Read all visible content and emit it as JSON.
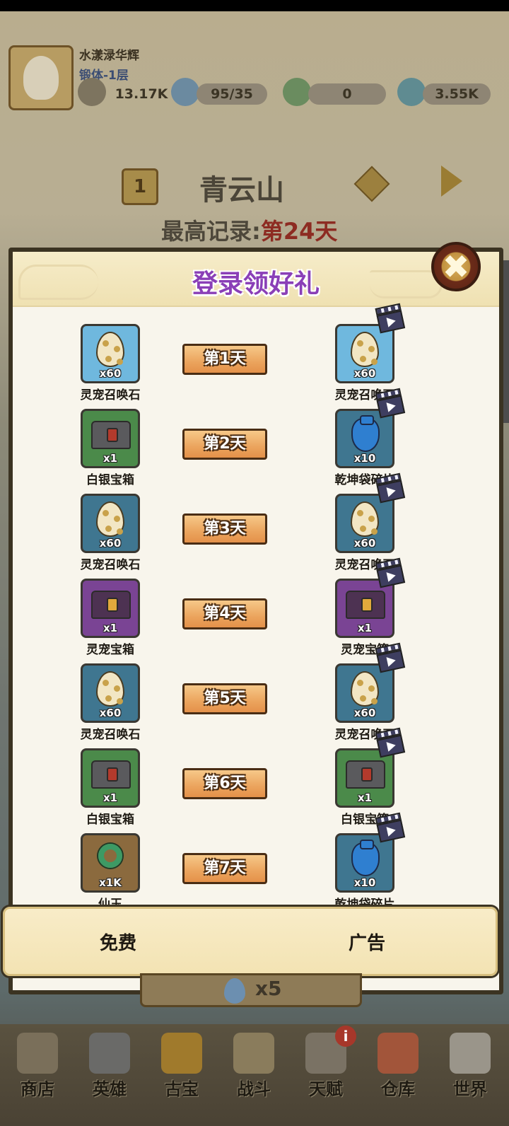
{
  "player": {
    "name": "水漾渌华辉",
    "rank": "锻体-1层",
    "power": "13.17K",
    "stamina": "95/35",
    "jade": "0",
    "crystal": "3.55K"
  },
  "region": {
    "level": "1",
    "name": "青云山",
    "record_label": "最高记录:",
    "record_value": "第24天"
  },
  "modal": {
    "title": "登录领好礼",
    "close_icon": "close-icon",
    "columns": {
      "free": "免费",
      "ad": "广告"
    },
    "rows": [
      {
        "day": "第1天",
        "free": {
          "name": "灵宠召唤石",
          "qty": "x60",
          "icon": "egg-icon",
          "tone": "light"
        },
        "ad": {
          "name": "灵宠召唤石",
          "qty": "x60",
          "icon": "egg-icon",
          "tone": "light"
        }
      },
      {
        "day": "第2天",
        "free": {
          "name": "白银宝箱",
          "qty": "x1",
          "icon": "silver-chest-icon",
          "tone": "green"
        },
        "ad": {
          "name": "乾坤袋碎片",
          "qty": "x10",
          "icon": "bag-icon",
          "tone": "blue"
        }
      },
      {
        "day": "第3天",
        "free": {
          "name": "灵宠召唤石",
          "qty": "x60",
          "icon": "egg-icon",
          "tone": "blue"
        },
        "ad": {
          "name": "灵宠召唤石",
          "qty": "x60",
          "icon": "egg-icon",
          "tone": "blue"
        }
      },
      {
        "day": "第4天",
        "free": {
          "name": "灵宠宝箱",
          "qty": "x1",
          "icon": "pet-chest-icon",
          "tone": "purple"
        },
        "ad": {
          "name": "灵宠宝箱",
          "qty": "x1",
          "icon": "pet-chest-icon",
          "tone": "purple"
        }
      },
      {
        "day": "第5天",
        "free": {
          "name": "灵宠召唤石",
          "qty": "x60",
          "icon": "egg-icon",
          "tone": "blue"
        },
        "ad": {
          "name": "灵宠召唤石",
          "qty": "x60",
          "icon": "egg-icon",
          "tone": "blue"
        }
      },
      {
        "day": "第6天",
        "free": {
          "name": "白银宝箱",
          "qty": "x1",
          "icon": "silver-chest-icon",
          "tone": "green"
        },
        "ad": {
          "name": "白银宝箱",
          "qty": "x1",
          "icon": "silver-chest-icon",
          "tone": "green"
        }
      },
      {
        "day": "第7天",
        "free": {
          "name": "仙玉",
          "qty": "x1K",
          "icon": "jade-ring-icon",
          "tone": "brown"
        },
        "ad": {
          "name": "乾坤袋碎片",
          "qty": "x10",
          "icon": "bag-icon",
          "tone": "blue"
        }
      }
    ]
  },
  "boost": {
    "label": "x5"
  },
  "nav": [
    {
      "label": "商店",
      "icon": "shop-icon"
    },
    {
      "label": "英雄",
      "icon": "hero-icon"
    },
    {
      "label": "古宝",
      "icon": "gourd-icon"
    },
    {
      "label": "战斗",
      "icon": "yinyang-icon"
    },
    {
      "label": "天赋",
      "icon": "talent-icon"
    },
    {
      "label": "仓库",
      "icon": "bag-icon"
    },
    {
      "label": "世界",
      "icon": "cloud-icon"
    }
  ],
  "nav_badge": "i",
  "colors": {
    "title": "#8a3fb7",
    "day_button": "#eba45d",
    "record_highlight": "#8d2b22"
  }
}
